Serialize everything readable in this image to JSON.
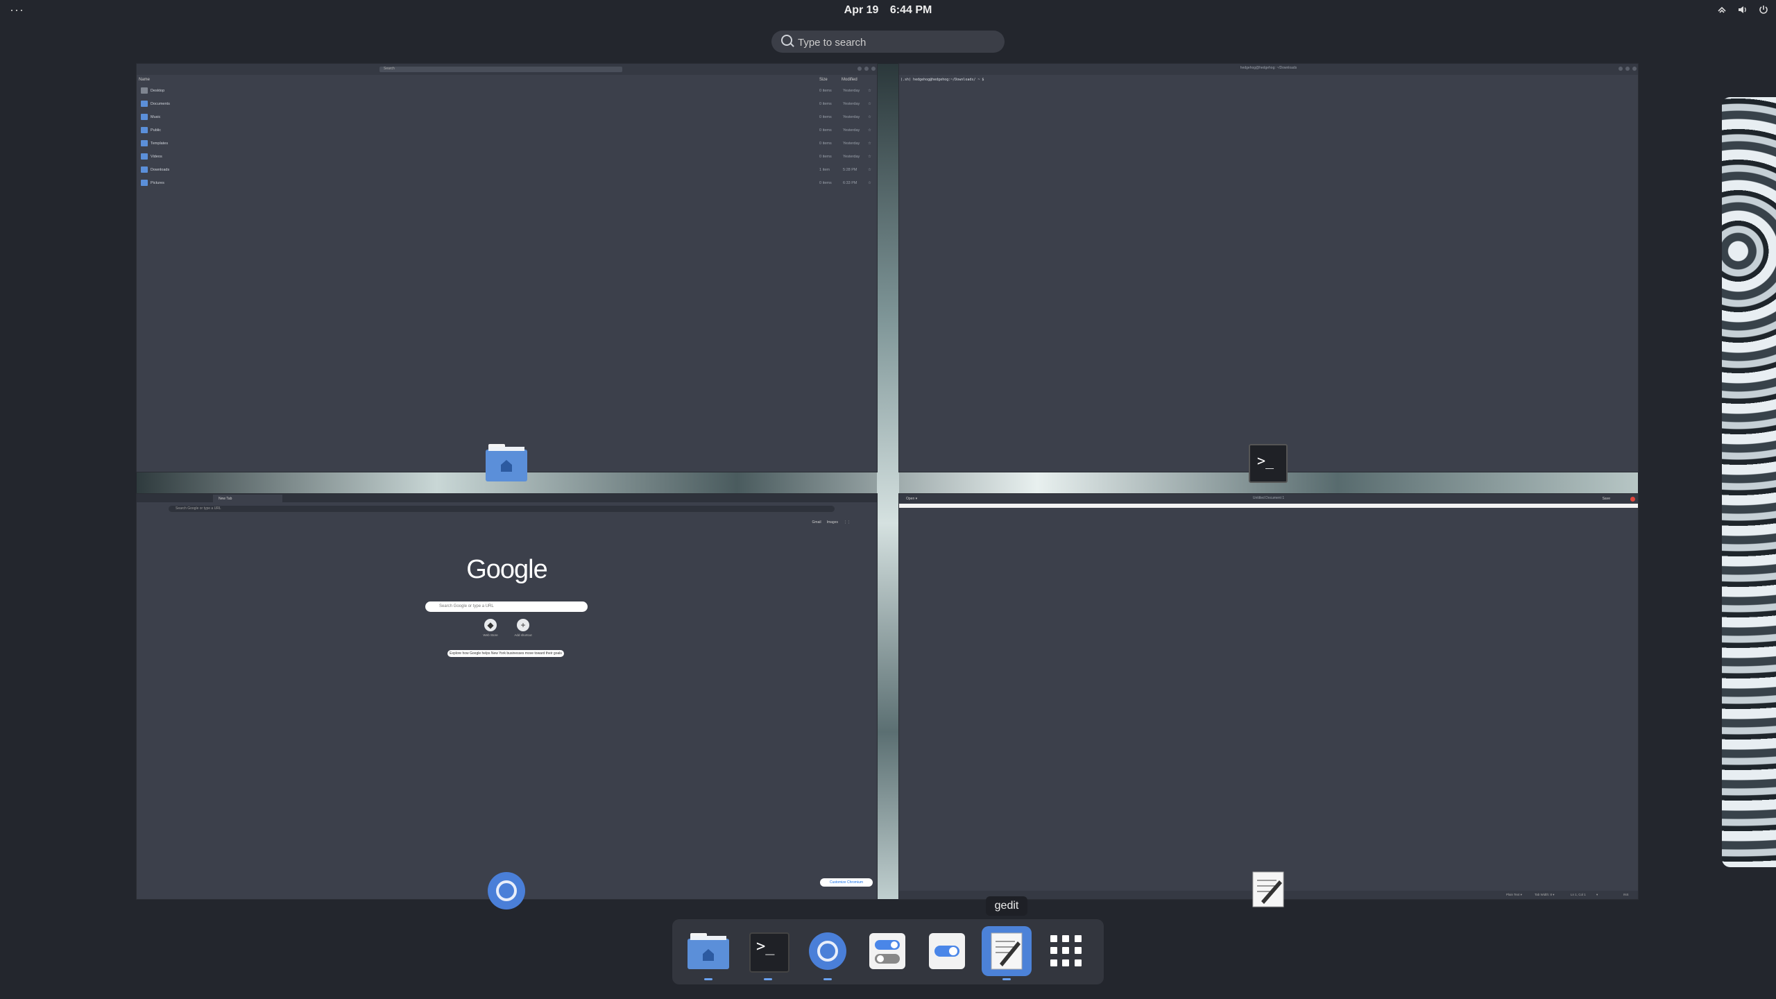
{
  "topbar": {
    "activities": "···",
    "date": "Apr 19",
    "time": "6:44 PM",
    "tray_icons": [
      "network-icon",
      "volume-icon",
      "power-icon"
    ]
  },
  "search": {
    "placeholder": "Type to search"
  },
  "windows": {
    "files": {
      "search_placeholder": "Search",
      "columns": {
        "name": "Name",
        "size": "Size",
        "modified": "Modified"
      },
      "rows": [
        {
          "name": "Desktop",
          "size": "0 items",
          "modified": "Yesterday"
        },
        {
          "name": "Documents",
          "size": "0 items",
          "modified": "Yesterday"
        },
        {
          "name": "Music",
          "size": "0 items",
          "modified": "Yesterday"
        },
        {
          "name": "Public",
          "size": "0 items",
          "modified": "Yesterday"
        },
        {
          "name": "Templates",
          "size": "0 items",
          "modified": "Yesterday"
        },
        {
          "name": "Videos",
          "size": "0 items",
          "modified": "Yesterday"
        },
        {
          "name": "Downloads",
          "size": "1 item",
          "modified": "5:28 PM"
        },
        {
          "name": "Pictures",
          "size": "0 items",
          "modified": "6:33 PM"
        }
      ]
    },
    "terminal": {
      "title": "hedgehog@hedgehog: ~/Downloads",
      "prompt": "(.sh) hedgehog@hedgehog:~/Downloads/ ~ $ "
    },
    "chrome": {
      "tab_title": "New Tab",
      "omnibox_placeholder": "Search Google or type a URL",
      "links": [
        "Gmail",
        "Images"
      ],
      "logo": "Google",
      "search_placeholder": "Search Google or type a URL",
      "shortcuts": [
        {
          "label": "Web Store",
          "glyph": "◆"
        },
        {
          "label": "Add shortcut",
          "glyph": "+"
        }
      ],
      "banner": "Explore how Google helps New York businesses move toward their goals",
      "customize": "Customize Chromium"
    },
    "gedit": {
      "open": "Open ▾",
      "title": "Untitled Document 1",
      "save": "Save",
      "status": [
        "Plain Text ▾",
        "Tab Width: 8 ▾",
        "Ln 1, Col 1",
        "▾",
        "INS"
      ]
    }
  },
  "dash": {
    "tooltip": "gedit",
    "items": [
      "Files",
      "Terminal",
      "Chromium",
      "Settings",
      "Tweaks",
      "gedit",
      "Show Applications"
    ],
    "colors": {
      "accent": "#4c82d8",
      "folder": "#5b8fd9"
    }
  }
}
